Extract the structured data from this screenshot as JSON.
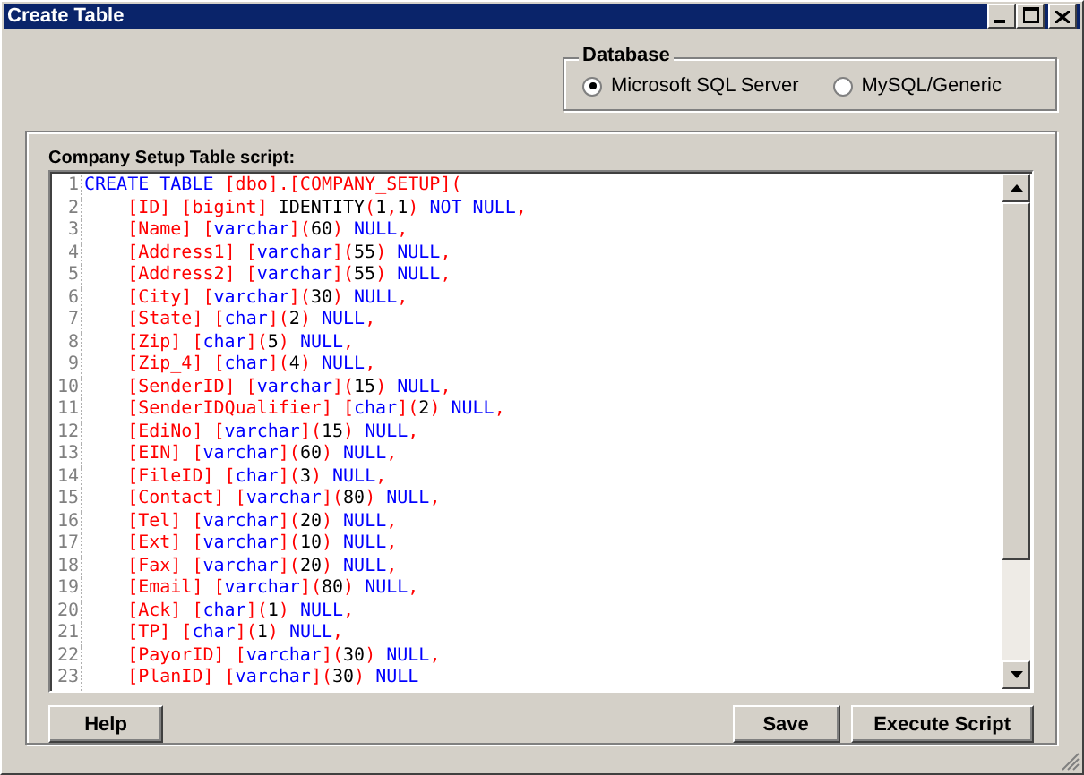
{
  "window": {
    "title": "Create Table"
  },
  "database": {
    "legend": "Database",
    "options": [
      {
        "label": "Microsoft SQL Server",
        "selected": true
      },
      {
        "label": "MySQL/Generic",
        "selected": false
      }
    ]
  },
  "script_panel": {
    "label": "Company Setup Table script:",
    "lines": [
      {
        "number": "1",
        "tokens": [
          {
            "kind": "keyword",
            "text": "CREATE TABLE "
          },
          {
            "kind": "punct",
            "text": "[dbo].[COMPANY_SETUP]("
          }
        ]
      },
      {
        "number": "2",
        "tokens": [
          {
            "kind": "punct",
            "text": "    [ID] [bigint] "
          },
          {
            "kind": "plain",
            "text": "IDENTITY"
          },
          {
            "kind": "punct",
            "text": "("
          },
          {
            "kind": "plain",
            "text": "1"
          },
          {
            "kind": "punct",
            "text": ","
          },
          {
            "kind": "plain",
            "text": "1"
          },
          {
            "kind": "punct",
            "text": ") "
          },
          {
            "kind": "keyword",
            "text": "NOT NULL"
          },
          {
            "kind": "punct",
            "text": ","
          }
        ]
      },
      {
        "number": "3",
        "tokens": [
          {
            "kind": "punct",
            "text": "    [Name] ["
          },
          {
            "kind": "keyword",
            "text": "varchar"
          },
          {
            "kind": "punct",
            "text": "]("
          },
          {
            "kind": "plain",
            "text": "60"
          },
          {
            "kind": "punct",
            "text": ") "
          },
          {
            "kind": "keyword",
            "text": "NULL"
          },
          {
            "kind": "punct",
            "text": ","
          }
        ]
      },
      {
        "number": "4",
        "tokens": [
          {
            "kind": "punct",
            "text": "    [Address1] ["
          },
          {
            "kind": "keyword",
            "text": "varchar"
          },
          {
            "kind": "punct",
            "text": "]("
          },
          {
            "kind": "plain",
            "text": "55"
          },
          {
            "kind": "punct",
            "text": ") "
          },
          {
            "kind": "keyword",
            "text": "NULL"
          },
          {
            "kind": "punct",
            "text": ","
          }
        ]
      },
      {
        "number": "5",
        "tokens": [
          {
            "kind": "punct",
            "text": "    [Address2] ["
          },
          {
            "kind": "keyword",
            "text": "varchar"
          },
          {
            "kind": "punct",
            "text": "]("
          },
          {
            "kind": "plain",
            "text": "55"
          },
          {
            "kind": "punct",
            "text": ") "
          },
          {
            "kind": "keyword",
            "text": "NULL"
          },
          {
            "kind": "punct",
            "text": ","
          }
        ]
      },
      {
        "number": "6",
        "tokens": [
          {
            "kind": "punct",
            "text": "    [City] ["
          },
          {
            "kind": "keyword",
            "text": "varchar"
          },
          {
            "kind": "punct",
            "text": "]("
          },
          {
            "kind": "plain",
            "text": "30"
          },
          {
            "kind": "punct",
            "text": ") "
          },
          {
            "kind": "keyword",
            "text": "NULL"
          },
          {
            "kind": "punct",
            "text": ","
          }
        ]
      },
      {
        "number": "7",
        "tokens": [
          {
            "kind": "punct",
            "text": "    [State] ["
          },
          {
            "kind": "keyword",
            "text": "char"
          },
          {
            "kind": "punct",
            "text": "]("
          },
          {
            "kind": "plain",
            "text": "2"
          },
          {
            "kind": "punct",
            "text": ") "
          },
          {
            "kind": "keyword",
            "text": "NULL"
          },
          {
            "kind": "punct",
            "text": ","
          }
        ]
      },
      {
        "number": "8",
        "tokens": [
          {
            "kind": "punct",
            "text": "    [Zip] ["
          },
          {
            "kind": "keyword",
            "text": "char"
          },
          {
            "kind": "punct",
            "text": "]("
          },
          {
            "kind": "plain",
            "text": "5"
          },
          {
            "kind": "punct",
            "text": ") "
          },
          {
            "kind": "keyword",
            "text": "NULL"
          },
          {
            "kind": "punct",
            "text": ","
          }
        ]
      },
      {
        "number": "9",
        "tokens": [
          {
            "kind": "punct",
            "text": "    [Zip_4] ["
          },
          {
            "kind": "keyword",
            "text": "char"
          },
          {
            "kind": "punct",
            "text": "]("
          },
          {
            "kind": "plain",
            "text": "4"
          },
          {
            "kind": "punct",
            "text": ") "
          },
          {
            "kind": "keyword",
            "text": "NULL"
          },
          {
            "kind": "punct",
            "text": ","
          }
        ]
      },
      {
        "number": "10",
        "tokens": [
          {
            "kind": "punct",
            "text": "    [SenderID] ["
          },
          {
            "kind": "keyword",
            "text": "varchar"
          },
          {
            "kind": "punct",
            "text": "]("
          },
          {
            "kind": "plain",
            "text": "15"
          },
          {
            "kind": "punct",
            "text": ") "
          },
          {
            "kind": "keyword",
            "text": "NULL"
          },
          {
            "kind": "punct",
            "text": ","
          }
        ]
      },
      {
        "number": "11",
        "tokens": [
          {
            "kind": "punct",
            "text": "    [SenderIDQualifier] ["
          },
          {
            "kind": "keyword",
            "text": "char"
          },
          {
            "kind": "punct",
            "text": "]("
          },
          {
            "kind": "plain",
            "text": "2"
          },
          {
            "kind": "punct",
            "text": ") "
          },
          {
            "kind": "keyword",
            "text": "NULL"
          },
          {
            "kind": "punct",
            "text": ","
          }
        ]
      },
      {
        "number": "12",
        "tokens": [
          {
            "kind": "punct",
            "text": "    [EdiNo] ["
          },
          {
            "kind": "keyword",
            "text": "varchar"
          },
          {
            "kind": "punct",
            "text": "]("
          },
          {
            "kind": "plain",
            "text": "15"
          },
          {
            "kind": "punct",
            "text": ") "
          },
          {
            "kind": "keyword",
            "text": "NULL"
          },
          {
            "kind": "punct",
            "text": ","
          }
        ]
      },
      {
        "number": "13",
        "tokens": [
          {
            "kind": "punct",
            "text": "    [EIN] ["
          },
          {
            "kind": "keyword",
            "text": "varchar"
          },
          {
            "kind": "punct",
            "text": "]("
          },
          {
            "kind": "plain",
            "text": "60"
          },
          {
            "kind": "punct",
            "text": ") "
          },
          {
            "kind": "keyword",
            "text": "NULL"
          },
          {
            "kind": "punct",
            "text": ","
          }
        ]
      },
      {
        "number": "14",
        "tokens": [
          {
            "kind": "punct",
            "text": "    [FileID] ["
          },
          {
            "kind": "keyword",
            "text": "char"
          },
          {
            "kind": "punct",
            "text": "]("
          },
          {
            "kind": "plain",
            "text": "3"
          },
          {
            "kind": "punct",
            "text": ") "
          },
          {
            "kind": "keyword",
            "text": "NULL"
          },
          {
            "kind": "punct",
            "text": ","
          }
        ]
      },
      {
        "number": "15",
        "tokens": [
          {
            "kind": "punct",
            "text": "    [Contact] ["
          },
          {
            "kind": "keyword",
            "text": "varchar"
          },
          {
            "kind": "punct",
            "text": "]("
          },
          {
            "kind": "plain",
            "text": "80"
          },
          {
            "kind": "punct",
            "text": ") "
          },
          {
            "kind": "keyword",
            "text": "NULL"
          },
          {
            "kind": "punct",
            "text": ","
          }
        ]
      },
      {
        "number": "16",
        "tokens": [
          {
            "kind": "punct",
            "text": "    [Tel] ["
          },
          {
            "kind": "keyword",
            "text": "varchar"
          },
          {
            "kind": "punct",
            "text": "]("
          },
          {
            "kind": "plain",
            "text": "20"
          },
          {
            "kind": "punct",
            "text": ") "
          },
          {
            "kind": "keyword",
            "text": "NULL"
          },
          {
            "kind": "punct",
            "text": ","
          }
        ]
      },
      {
        "number": "17",
        "tokens": [
          {
            "kind": "punct",
            "text": "    [Ext] ["
          },
          {
            "kind": "keyword",
            "text": "varchar"
          },
          {
            "kind": "punct",
            "text": "]("
          },
          {
            "kind": "plain",
            "text": "10"
          },
          {
            "kind": "punct",
            "text": ") "
          },
          {
            "kind": "keyword",
            "text": "NULL"
          },
          {
            "kind": "punct",
            "text": ","
          }
        ]
      },
      {
        "number": "18",
        "tokens": [
          {
            "kind": "punct",
            "text": "    [Fax] ["
          },
          {
            "kind": "keyword",
            "text": "varchar"
          },
          {
            "kind": "punct",
            "text": "]("
          },
          {
            "kind": "plain",
            "text": "20"
          },
          {
            "kind": "punct",
            "text": ") "
          },
          {
            "kind": "keyword",
            "text": "NULL"
          },
          {
            "kind": "punct",
            "text": ","
          }
        ]
      },
      {
        "number": "19",
        "tokens": [
          {
            "kind": "punct",
            "text": "    [Email] ["
          },
          {
            "kind": "keyword",
            "text": "varchar"
          },
          {
            "kind": "punct",
            "text": "]("
          },
          {
            "kind": "plain",
            "text": "80"
          },
          {
            "kind": "punct",
            "text": ") "
          },
          {
            "kind": "keyword",
            "text": "NULL"
          },
          {
            "kind": "punct",
            "text": ","
          }
        ]
      },
      {
        "number": "20",
        "tokens": [
          {
            "kind": "punct",
            "text": "    [Ack] ["
          },
          {
            "kind": "keyword",
            "text": "char"
          },
          {
            "kind": "punct",
            "text": "]("
          },
          {
            "kind": "plain",
            "text": "1"
          },
          {
            "kind": "punct",
            "text": ") "
          },
          {
            "kind": "keyword",
            "text": "NULL"
          },
          {
            "kind": "punct",
            "text": ","
          }
        ]
      },
      {
        "number": "21",
        "tokens": [
          {
            "kind": "punct",
            "text": "    [TP] ["
          },
          {
            "kind": "keyword",
            "text": "char"
          },
          {
            "kind": "punct",
            "text": "]("
          },
          {
            "kind": "plain",
            "text": "1"
          },
          {
            "kind": "punct",
            "text": ") "
          },
          {
            "kind": "keyword",
            "text": "NULL"
          },
          {
            "kind": "punct",
            "text": ","
          }
        ]
      },
      {
        "number": "22",
        "tokens": [
          {
            "kind": "punct",
            "text": "    [PayorID] ["
          },
          {
            "kind": "keyword",
            "text": "varchar"
          },
          {
            "kind": "punct",
            "text": "]("
          },
          {
            "kind": "plain",
            "text": "30"
          },
          {
            "kind": "punct",
            "text": ") "
          },
          {
            "kind": "keyword",
            "text": "NULL"
          },
          {
            "kind": "punct",
            "text": ","
          }
        ]
      },
      {
        "number": "23",
        "tokens": [
          {
            "kind": "punct",
            "text": "    [PlanID] ["
          },
          {
            "kind": "keyword",
            "text": "varchar"
          },
          {
            "kind": "punct",
            "text": "]("
          },
          {
            "kind": "plain",
            "text": "30"
          },
          {
            "kind": "punct",
            "text": ") "
          },
          {
            "kind": "keyword",
            "text": "NULL"
          }
        ]
      }
    ]
  },
  "buttons": {
    "left": [
      "Help"
    ],
    "right": [
      "Save",
      "Execute Script"
    ]
  }
}
